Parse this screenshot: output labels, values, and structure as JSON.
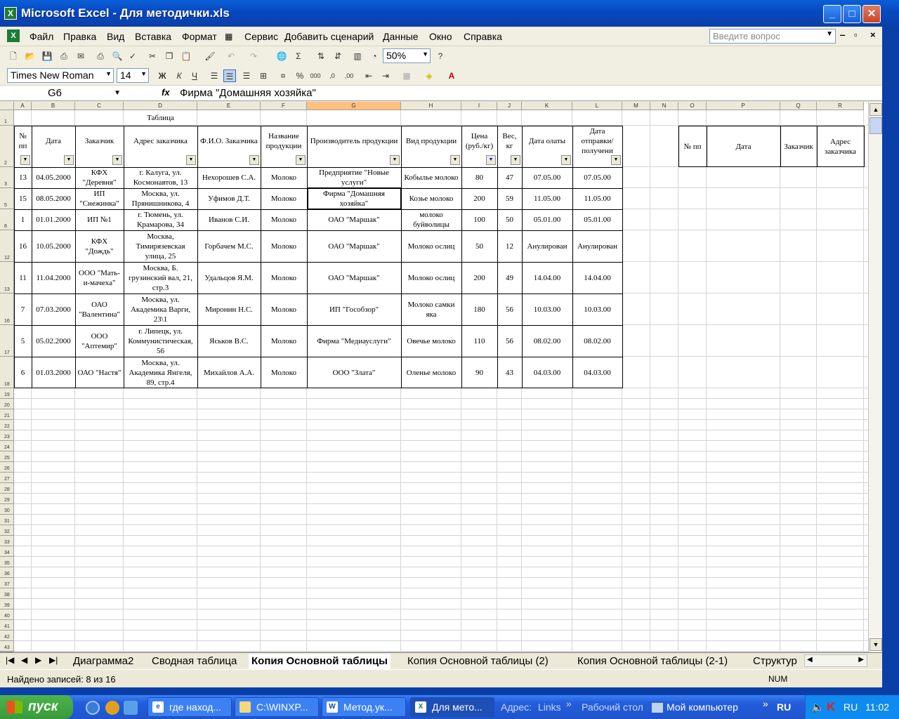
{
  "window": {
    "title": "Microsoft Excel - Для методички.xls",
    "controls": [
      "_",
      "□",
      "✕"
    ]
  },
  "menu": [
    "Файл",
    "Правка",
    "Вид",
    "Вставка",
    "Формат",
    "Сервис",
    "Добавить сценарий",
    "Данные",
    "Окно",
    "Справка"
  ],
  "ask_placeholder": "Введите вопрос",
  "toolbar": {
    "zoom": "50%",
    "font": "Times New Roman",
    "size": "14"
  },
  "formula_bar": {
    "name_box": "G6",
    "fx": "fx",
    "content": "Фирма \"Домашняя хозяйка\""
  },
  "columns": [
    "A",
    "B",
    "C",
    "D",
    "E",
    "F",
    "G",
    "H",
    "I",
    "J",
    "K",
    "L",
    "M",
    "N",
    "O",
    "P",
    "Q",
    "R"
  ],
  "selected_column": "G",
  "table": {
    "caption": "Таблица",
    "headers": [
      "№ пп",
      "Дата",
      "Заказчик",
      "Адрес заказчика",
      "Ф.И.О. Заказчика",
      "Название продукции",
      "Производитель продукции",
      "Вид продукции",
      "Цена (руб./кг)",
      "Вес, кг",
      "Дата олаты",
      "Дата отправки/получени"
    ],
    "row_numbers": [
      "3",
      "5",
      "8",
      "12",
      "13",
      "16",
      "17",
      "18"
    ],
    "rows": [
      [
        "13",
        "04.05.2000",
        "КФХ \"Деревня\"",
        "г. Калуга, ул. Космонавтов, 13",
        "Нехорошев С.А.",
        "Молоко",
        "Предприятие \"Новые услуги\"",
        "Кобылье молоко",
        "80",
        "47",
        "07.05.00",
        "07.05.00"
      ],
      [
        "15",
        "08.05.2000",
        "ИП \"Снежинка\"",
        "Москва, ул. Прянишникова, 4",
        "Уфимов Д.Т.",
        "Молоко",
        "Фирма \"Домашняя хозяйка\"",
        "Козье молоко",
        "200",
        "59",
        "11.05.00",
        "11.05.00"
      ],
      [
        "1",
        "01.01.2000",
        "ИП №1",
        "г. Тюмень, ул. Крамарова, 34",
        "Иванов С.И.",
        "Молоко",
        "ОАО \"Маршак\"",
        "молоко буйволицы",
        "100",
        "50",
        "05.01.00",
        "05.01.00"
      ],
      [
        "16",
        "10.05.2000",
        "КФХ \"Дождь\"",
        "Москва, Тимирязевская улица, 25",
        "Горбачем М.С.",
        "Молоко",
        "ОАО \"Маршак\"",
        "Молоко ослиц",
        "50",
        "12",
        "Анулирован",
        "Анулирован"
      ],
      [
        "11",
        "11.04.2000",
        "ООО \"Мать-и-мачеха\"",
        "Москва, Б. грузинский вал, 21, стр.3",
        "Удальцов Я.М.",
        "Молоко",
        "ОАО \"Маршак\"",
        "Молоко ослиц",
        "200",
        "49",
        "14.04.00",
        "14.04.00"
      ],
      [
        "7",
        "07.03.2000",
        "ОАО \"Валентина\"",
        "Москва, ул. Академика Варги, 23\\1",
        "Миронин Н.С.",
        "Молоко",
        "ИП \"Гособзор\"",
        "Молоко самки яка",
        "180",
        "56",
        "10.03.00",
        "10.03.00"
      ],
      [
        "5",
        "05.02.2000",
        "ООО \"Аптемир\"",
        "г. Липецк, ул. Коммунистическая, 56",
        "Яськов В.С.",
        "Молоко",
        "Фирма \"Медиауслуги\"",
        "Овечье молоко",
        "110",
        "56",
        "08.02.00",
        "08.02.00"
      ],
      [
        "6",
        "01.03.2000",
        "ОАО \"Настя\"",
        "Москва, ул. Академика Янгеля, 89, стр.4",
        "Михайлов А.А.",
        "Молоко",
        "ООО \"Злата\"",
        "Оленье молоко",
        "90",
        "43",
        "04.03.00",
        "04.03.00"
      ]
    ]
  },
  "side_table_headers": [
    "№ пп",
    "Дата",
    "Заказчик",
    "Адрес заказчика"
  ],
  "sheet_tabs": [
    "Диаграмма2",
    "Сводная таблица",
    "Копия Основной таблицы",
    "Копия Основной таблицы (2)",
    "Копия Основной таблицы (2-1)",
    "Структур"
  ],
  "active_tab": "Копия Основной таблицы",
  "status": {
    "text": "Найдено записей: 8 из 16",
    "num": "NUM"
  },
  "taskbar": {
    "start": "пуск",
    "items": [
      "где наход...",
      "C:\\WINXP...",
      "Метод.ук...",
      "Для мето..."
    ],
    "address_label": "Адрес:",
    "links": "Links",
    "desktop": "Рабочий стол",
    "mycomputer": "Мой компьютер",
    "lang": "RU",
    "tray_lang": "RU",
    "clock": "11:02"
  }
}
